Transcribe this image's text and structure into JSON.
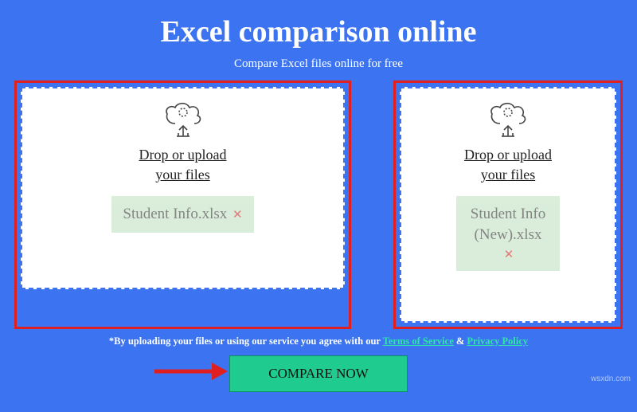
{
  "header": {
    "title": "Excel comparison online",
    "subtitle": "Compare Excel files online for free"
  },
  "dropzone_label_line1": "Drop or upload",
  "dropzone_label_line2": "your files",
  "files": {
    "left": {
      "name": "Student Info.xlsx"
    },
    "right": {
      "name": "Student Info (New).xlsx"
    }
  },
  "terms": {
    "prefix": "*By uploading your files or using our service you agree with our ",
    "tos_label": "Terms of Service",
    "amp": " & ",
    "privacy_label": "Privacy Policy"
  },
  "compare_button_label": "COMPARE NOW",
  "watermark": "wsxdn.com"
}
